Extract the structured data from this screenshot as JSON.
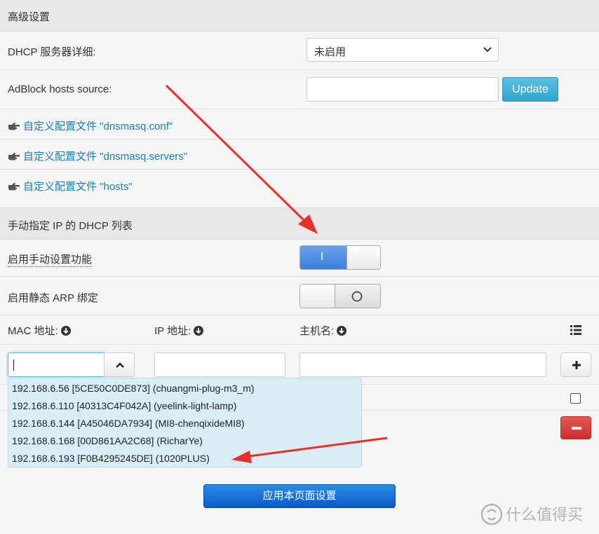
{
  "advanced": {
    "header": "高级设置",
    "dhcp_detail_label": "DHCP 服务器详细:",
    "dhcp_detail_value": "未启用",
    "adblock_label": "AdBlock hosts source:",
    "adblock_value": "",
    "update_label": "Update",
    "links": [
      "自定义配置文件 \"dnsmasq.conf\"",
      "自定义配置文件 \"dnsmasq.servers\"",
      "自定义配置文件 \"hosts\""
    ]
  },
  "manual": {
    "header": "手动指定 IP 的 DHCP 列表",
    "enable_label": "启用手动设置功能",
    "enable_on": true,
    "enable_glyph": "I",
    "arp_label": "启用静态 ARP 绑定",
    "arp_on": false,
    "columns": {
      "mac": "MAC 地址:",
      "ip": "IP 地址:",
      "host": "主机名:"
    },
    "mac_value": "",
    "ip_value": "",
    "host_value": "",
    "suggestions": [
      "192.168.6.56 [5CE50C0DE873] (chuangmi-plug-m3_m)",
      "192.168.6.110 [40313C4F042A] (yeelink-light-lamp)",
      "192.168.6.144 [A45046DA7934] (MI8-chenqixideMI8)",
      "192.168.6.168 [00D861AA2C68] (RicharYe)",
      "192.168.6.193 [F0B4295245DE] (1020PLUS)"
    ]
  },
  "apply_label": "应用本页面设置",
  "watermark": "什么值得买",
  "colors": {
    "link": "#1a7fb8",
    "annotation_arrow": "#e8312a",
    "delete": "#d9302a"
  },
  "icons": {
    "chevron": "chevron-down-icon",
    "hand": "hand-point-icon",
    "download": "circle-arrow-down-icon",
    "list": "list-icon",
    "plus": "plus-icon",
    "minus": "minus-icon"
  }
}
